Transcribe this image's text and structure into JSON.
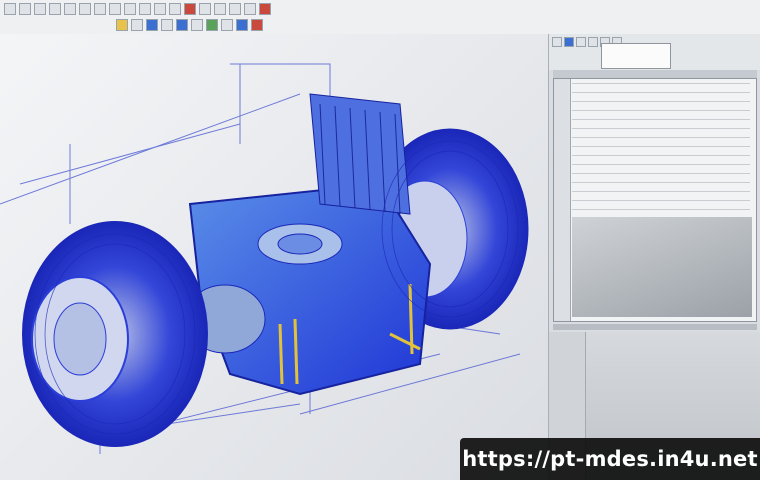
{
  "app": {
    "accent_color": "#1f35d6",
    "wire_color": "#2b3fd8",
    "highlight_color": "#e3c23b"
  },
  "toolbar": {
    "icons": [
      "new-file-icon",
      "open-folder-icon",
      "save-icon",
      "print-icon",
      "undo-icon",
      "redo-icon",
      "select-icon",
      "move-icon",
      "rotate-icon",
      "zoom-icon",
      "pan-icon",
      "render-icon",
      "record-icon",
      "layer-icon",
      "grid-icon",
      "settings-icon"
    ]
  },
  "viewport": {
    "model_description_icon": "wireframe-3d-model-icon"
  },
  "right_panel": {
    "dialog_icon": "properties-dialog-icon"
  },
  "watermark": {
    "text": "https://pt-mdes.in4u.net"
  }
}
